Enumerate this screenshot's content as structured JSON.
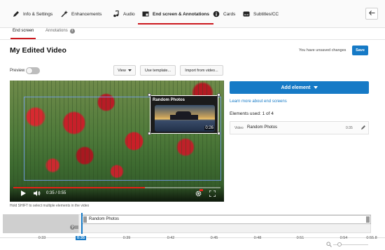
{
  "tabs": [
    {
      "label": "Info & Settings",
      "icon": "pencil-icon"
    },
    {
      "label": "Enhancements",
      "icon": "magic-wand-icon"
    },
    {
      "label": "Audio",
      "icon": "music-note-icon"
    },
    {
      "label": "End screen & Annotations",
      "icon": "end-screen-icon"
    },
    {
      "label": "Cards",
      "icon": "info-circle-icon"
    },
    {
      "label": "Subtitles/CC",
      "icon": "subtitles-icon"
    }
  ],
  "subtabs": {
    "end_screen": "End screen",
    "annotations": "Annotations"
  },
  "page_title": "My Edited Video",
  "unsaved_text": "You have unsaved changes",
  "save_label": "Save",
  "preview_label": "Preview",
  "toolbar": {
    "view": "View",
    "use_template": "Use template...",
    "import_video": "Import from video..."
  },
  "player": {
    "current_time": "0:35 / 0:55",
    "progress_fraction": 0.636
  },
  "end_card": {
    "title": "Random Photos",
    "duration": "0:26"
  },
  "hint": "Hold SHIFT to select multiple elements in the video",
  "right_panel": {
    "add_element": "Add element",
    "learn_more": "Learn more about end screens",
    "elements_used": "Elements used: 1 of 4",
    "element": {
      "type": "Video",
      "name": "Random Photos",
      "time": "0:35"
    }
  },
  "timeline": {
    "track_label": "Random Photos",
    "current_time": "0:35",
    "ticks": [
      "0:33",
      "0:39",
      "0:42",
      "0:45",
      "0:48",
      "0:51",
      "0:54",
      "0:55.8"
    ]
  },
  "colors": {
    "accent": "#167ac6",
    "tab_underline": "#cc181e"
  }
}
